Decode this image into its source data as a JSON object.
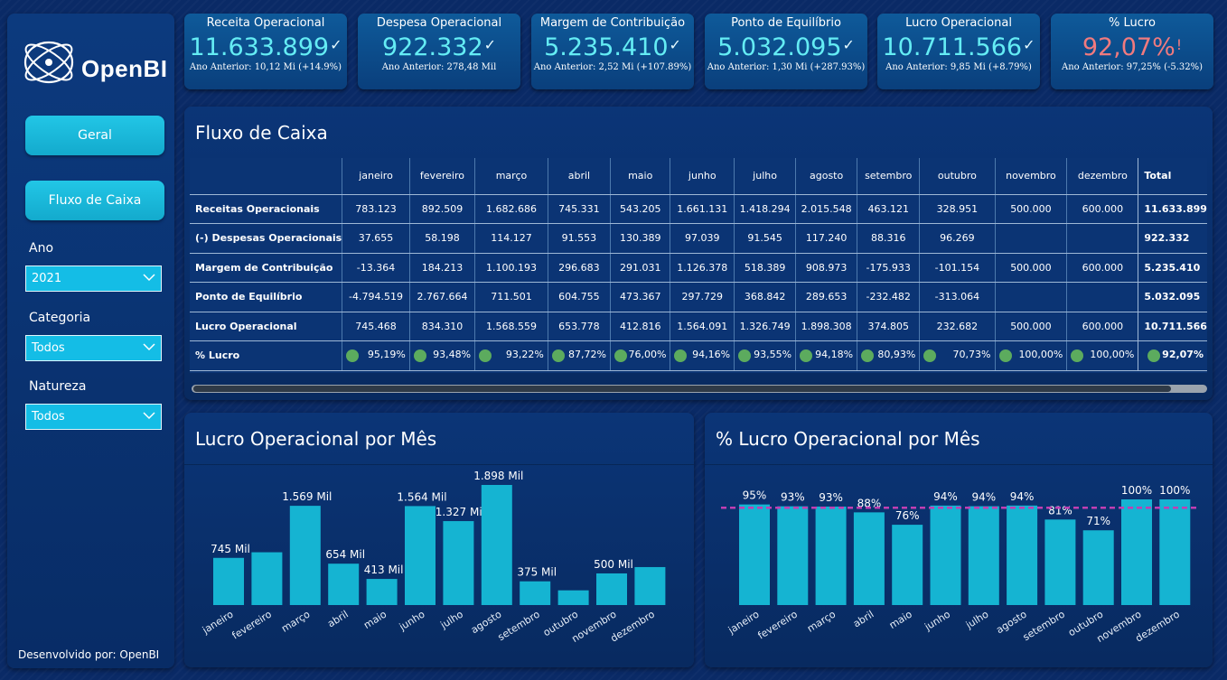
{
  "sidebar": {
    "logo_text": "OpenBI",
    "nav": [
      "Geral",
      "Fluxo de Caixa"
    ],
    "filters": [
      {
        "label": "Ano",
        "value": "2021"
      },
      {
        "label": "Categoria",
        "value": "Todos"
      },
      {
        "label": "Natureza",
        "value": "Todos"
      }
    ],
    "developer": "Desenvolvido por: OpenBI"
  },
  "kpis": [
    {
      "title": "Receita Operacional",
      "value": "11.633.899",
      "sub": "Ano Anterior: 10,12 Mi (+14.9%)",
      "icon": "check-icon"
    },
    {
      "title": "Despesa Operacional",
      "value": "922.332",
      "sub": "Ano Anterior: 278,48 Mil",
      "icon": "check-icon"
    },
    {
      "title": "Margem de Contribuição",
      "value": "5.235.410",
      "sub": "Ano Anterior: 2,52 Mi (+107.89%)",
      "icon": "check-icon"
    },
    {
      "title": "Ponto de Equilíbrio",
      "value": "5.032.095",
      "sub": "Ano Anterior: 1,30 Mi (+287.93%)",
      "icon": "check-icon"
    },
    {
      "title": "Lucro Operacional",
      "value": "10.711.566",
      "sub": "Ano Anterior: 9,85 Mi (+8.79%)",
      "icon": "check-icon"
    },
    {
      "title": "% Lucro",
      "value": "92,07%",
      "sub": "Ano Anterior: 97,25% (-5.32%)",
      "icon": "exclamation-icon",
      "status_color": "#f07a7e"
    }
  ],
  "fluxo": {
    "title": "Fluxo de Caixa",
    "columns": [
      "janeiro",
      "fevereiro",
      "março",
      "abril",
      "maio",
      "junho",
      "julho",
      "agosto",
      "setembro",
      "outubro",
      "novembro",
      "dezembro",
      "Total"
    ],
    "rows": [
      {
        "label": "Receitas Operacionais",
        "cells": [
          "783.123",
          "892.509",
          "1.682.686",
          "745.331",
          "543.205",
          "1.661.131",
          "1.418.294",
          "2.015.548",
          "463.121",
          "328.951",
          "500.000",
          "600.000",
          "11.633.899"
        ]
      },
      {
        "label": "(-) Despesas Operacionais",
        "cells": [
          "37.655",
          "58.198",
          "114.127",
          "91.553",
          "130.389",
          "97.039",
          "91.545",
          "117.240",
          "88.316",
          "96.269",
          "",
          "",
          "922.332"
        ]
      },
      {
        "label": "Margem de Contribuição",
        "cells": [
          "-13.364",
          "184.213",
          "1.100.193",
          "296.683",
          "291.031",
          "1.126.378",
          "518.389",
          "908.973",
          "-175.933",
          "-101.154",
          "500.000",
          "600.000",
          "5.235.410"
        ]
      },
      {
        "label": "Ponto de Equilíbrio",
        "cells": [
          "-4.794.519",
          "2.767.664",
          "711.501",
          "604.755",
          "473.367",
          "297.729",
          "368.842",
          "289.653",
          "-232.482",
          "-313.064",
          "",
          "",
          "5.032.095"
        ]
      },
      {
        "label": "Lucro Operacional",
        "cells": [
          "745.468",
          "834.310",
          "1.568.559",
          "653.778",
          "412.816",
          "1.564.091",
          "1.326.749",
          "1.898.308",
          "374.805",
          "232.682",
          "500.000",
          "600.000",
          "10.711.566"
        ]
      }
    ],
    "pct_row": {
      "label": "% Lucro",
      "cells": [
        "95,19%",
        "93,48%",
        "93,22%",
        "87,72%",
        "76,00%",
        "94,16%",
        "93,55%",
        "94,18%",
        "80,93%",
        "70,73%",
        "100,00%",
        "100,00%",
        "92,07%"
      ],
      "indicator_color": "#5cab5e"
    }
  },
  "chart_data": [
    {
      "type": "bar",
      "title": "Lucro Operacional por Mês",
      "categories": [
        "janeiro",
        "fevereiro",
        "março",
        "abril",
        "maio",
        "junho",
        "julho",
        "agosto",
        "setembro",
        "outubro",
        "novembro",
        "dezembro"
      ],
      "values": [
        745468,
        834310,
        1568559,
        653778,
        412816,
        1564091,
        1326749,
        1898308,
        374805,
        232682,
        500000,
        600000
      ],
      "data_labels": [
        "745 Mil",
        "",
        "1.569 Mil",
        "654 Mil",
        "413 Mil",
        "1.564 Mil",
        "1.327 Mil",
        "1.898 Mil",
        "375 Mil",
        "",
        "500 Mil",
        ""
      ],
      "ylim": [
        0,
        1898308
      ],
      "color": "#15b4d2"
    },
    {
      "type": "bar",
      "title": "% Lucro Operacional por Mês",
      "categories": [
        "janeiro",
        "fevereiro",
        "março",
        "abril",
        "maio",
        "junho",
        "julho",
        "agosto",
        "setembro",
        "outubro",
        "novembro",
        "dezembro"
      ],
      "values": [
        95.19,
        93.48,
        93.22,
        87.72,
        76.0,
        94.16,
        93.55,
        94.18,
        80.93,
        70.73,
        100.0,
        100.0
      ],
      "data_labels": [
        "95%",
        "93%",
        "93%",
        "88%",
        "76%",
        "94%",
        "94%",
        "94%",
        "81%",
        "71%",
        "100%",
        "100%"
      ],
      "reference_line": 92.07,
      "reference_color": "#c13fb3",
      "ylim": [
        0,
        100
      ],
      "color": "#15b4d2"
    }
  ]
}
